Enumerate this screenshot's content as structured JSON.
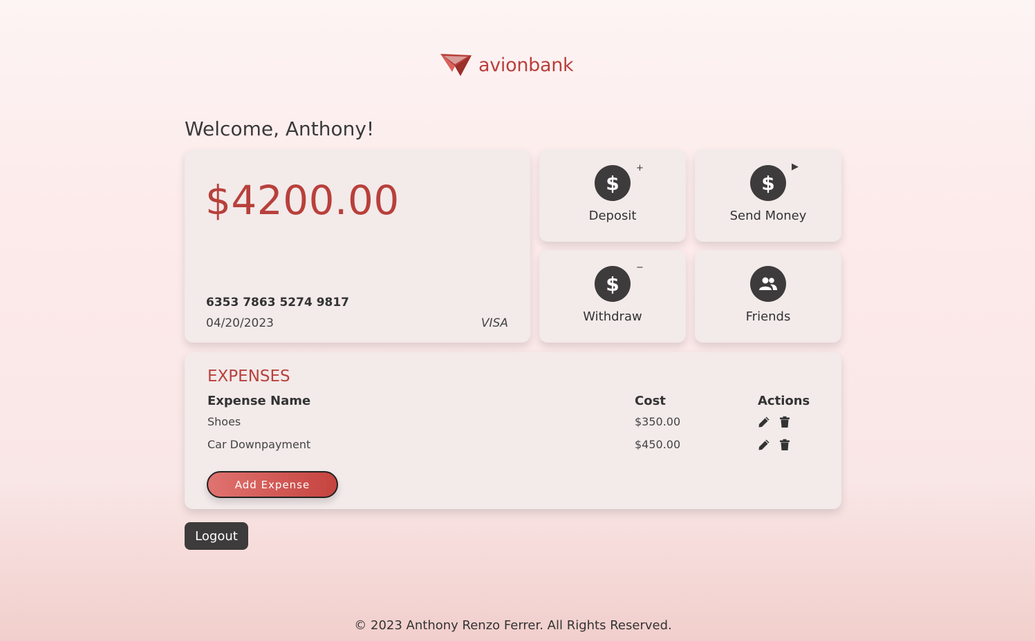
{
  "brand": {
    "name": "avionbank",
    "logo_icon": "paper-plane-icon",
    "color": "#b8403b"
  },
  "welcome": "Welcome, Anthony!",
  "account": {
    "balance": "$4200.00",
    "card_number": "6353 7863 5274 9817",
    "date": "04/20/2023",
    "card_brand": "VISA"
  },
  "actions": [
    {
      "label": "Deposit",
      "icon": "dollar-icon",
      "mark": "+"
    },
    {
      "label": "Send Money",
      "icon": "dollar-icon",
      "mark": "▶"
    },
    {
      "label": "Withdraw",
      "icon": "dollar-icon",
      "mark": "−"
    },
    {
      "label": "Friends",
      "icon": "users-icon",
      "mark": ""
    }
  ],
  "expenses": {
    "title": "EXPENSES",
    "headers": {
      "name": "Expense Name",
      "cost": "Cost",
      "actions": "Actions"
    },
    "rows": [
      {
        "name": "Shoes",
        "cost": "$350.00"
      },
      {
        "name": "Car Downpayment",
        "cost": "$450.00"
      }
    ],
    "add_label": "Add Expense"
  },
  "logout_label": "Logout",
  "footer": "© 2023 Anthony Renzo Ferrer. All Rights Reserved.",
  "colors": {
    "accent": "#b8403b",
    "dark": "#3d3b3b",
    "card": "#f3eaea"
  }
}
